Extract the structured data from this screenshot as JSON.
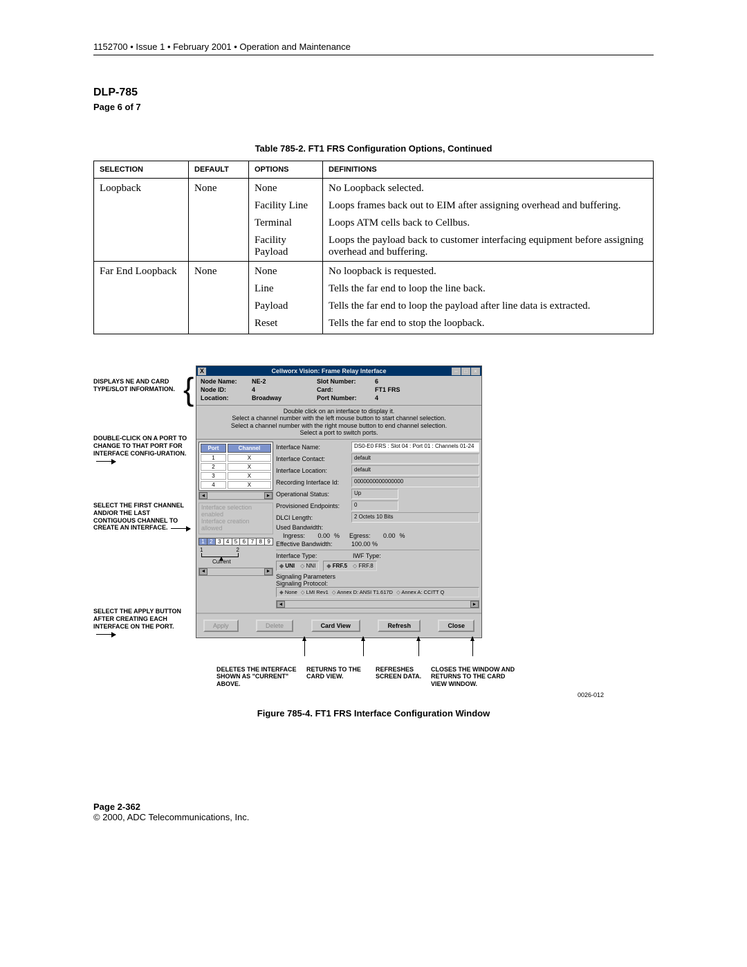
{
  "header": "1152700 • Issue 1 • February 2001 • Operation and Maintenance",
  "dlp": "DLP-785",
  "pageof": "Page 6 of 7",
  "table_caption": "Table 785-2. FT1 FRS Configuration Options, Continued",
  "table_headers": [
    "SELECTION",
    "DEFAULT",
    "OPTIONS",
    "DEFINITIONS"
  ],
  "rows": [
    {
      "sel": "Loopback",
      "def": "None",
      "opt": "None",
      "defn": "No Loopback selected."
    },
    {
      "sel": "",
      "def": "",
      "opt": "Facility Line",
      "defn": "Loops frames back out to EIM after assigning overhead and buffering."
    },
    {
      "sel": "",
      "def": "",
      "opt": "Terminal",
      "defn": "Loops ATM cells back to Cellbus."
    },
    {
      "sel": "",
      "def": "",
      "opt": "Facility Payload",
      "defn": "Loops the payload back to customer interfacing equipment before assigning overhead and buffering."
    },
    {
      "sel": "Far End Loopback",
      "def": "None",
      "opt": "None",
      "defn": "No loopback is requested."
    },
    {
      "sel": "",
      "def": "",
      "opt": "Line",
      "defn": "Tells the far end to loop the line back."
    },
    {
      "sel": "",
      "def": "",
      "opt": "Payload",
      "defn": "Tells the far end to loop the payload after line data is extracted."
    },
    {
      "sel": "",
      "def": "",
      "opt": "Reset",
      "defn": "Tells the far end to stop the loopback."
    }
  ],
  "callouts": {
    "info": "DISPLAYS NE AND CARD TYPE/SLOT INFORMATION.",
    "port": "DOUBLE-CLICK ON A PORT TO CHANGE TO THAT PORT FOR INTERFACE CONFIG-URATION.",
    "chan": "SELECT THE FIRST CHANNEL AND/OR THE LAST CONTIGUOUS CHANNEL TO CREATE AN INTERFACE.",
    "apply": "SELECT THE APPLY BUTTON AFTER CREATING EACH INTERFACE ON THE PORT."
  },
  "window": {
    "title": "Cellworx Vision: Frame Relay Interface",
    "hdr": {
      "node_name_lbl": "Node Name:",
      "node_name": "NE-2",
      "slot_lbl": "Slot Number:",
      "slot": "6",
      "node_id_lbl": "Node ID:",
      "node_id": "4",
      "card_lbl": "Card:",
      "card": "FT1 FRS",
      "loc_lbl": "Location:",
      "loc": "Broadway",
      "port_lbl": "Port Number:",
      "port": "4"
    },
    "instr1": "Double click on an interface to display it.",
    "instr2": "Select a channel number with the left mouse button to start channel selection.",
    "instr3": "Select a channel number with the right mouse button to end channel selection.",
    "instr4": "Select a port to switch ports.",
    "porthdr": {
      "a": "Port",
      "b": "Channel"
    },
    "ports": [
      [
        "1",
        "X"
      ],
      [
        "2",
        "X"
      ],
      [
        "3",
        "X"
      ],
      [
        "4",
        "X"
      ]
    ],
    "disabled1": "Interface selection enabled",
    "disabled2": "Interface creation allowed",
    "channels": [
      "1",
      "2",
      "3",
      "4",
      "5",
      "6",
      "7",
      "8",
      "9"
    ],
    "current": "Current",
    "fields": {
      "ifname_lbl": "Interface Name:",
      "ifname": "DS0-E0 FRS : Slot 04 : Port 01 : Channels 01-24",
      "ifcontact_lbl": "Interface Contact:",
      "ifcontact": "default",
      "ifloc_lbl": "Interface Location:",
      "ifloc": "default",
      "recid_lbl": "Recording Interface Id:",
      "recid": "0000000000000000",
      "opstat_lbl": "Operational Status:",
      "opstat": "Up",
      "provep_lbl": "Provisioned Endpoints:",
      "provep": "0",
      "dlci_lbl": "DLCI Length:",
      "dlci": "2 Octets 10 Bits",
      "usedbw_lbl": "Used Bandwidth:",
      "ingress_lbl": "Ingress:",
      "ingress": "0.00",
      "pct": "%",
      "egress_lbl": "Egress:",
      "egress": "0.00",
      "effbw_lbl": "Effective Bandwidth:",
      "effbw": "100.00 %",
      "iftype_lbl": "Interface Type:",
      "iwf_lbl": "IWF Type:",
      "uni": "UNI",
      "nni": "NNI",
      "frf5": "FRF.5",
      "frf8": "FRF.8",
      "sigparm_lbl": "Signaling Parameters",
      "sigprot_lbl": "Signaling Protocol:",
      "sp_none": "None",
      "sp_lmi": "LMI Rev1",
      "sp_annexd": "Annex D: ANSI T1.617D",
      "sp_annexa": "Annex A: CCITT Q"
    },
    "buttons": {
      "apply": "Apply",
      "delete": "Delete",
      "cardview": "Card View",
      "refresh": "Refresh",
      "close": "Close"
    }
  },
  "bottom": {
    "del": "DELETES THE INTERFACE SHOWN AS \"CURRENT\" ABOVE.",
    "ret": "RETURNS TO THE CARD VIEW.",
    "ref": "REFRESHES SCREEN DATA.",
    "close": "CLOSES THE WINDOW AND RETURNS TO THE CARD VIEW WINDOW."
  },
  "fignum": "0026-012",
  "figcaption": "Figure 785-4. FT1 FRS Interface Configuration Window",
  "footer_page": "Page 2-362",
  "footer_copy": "© 2000, ADC Telecommunications, Inc."
}
